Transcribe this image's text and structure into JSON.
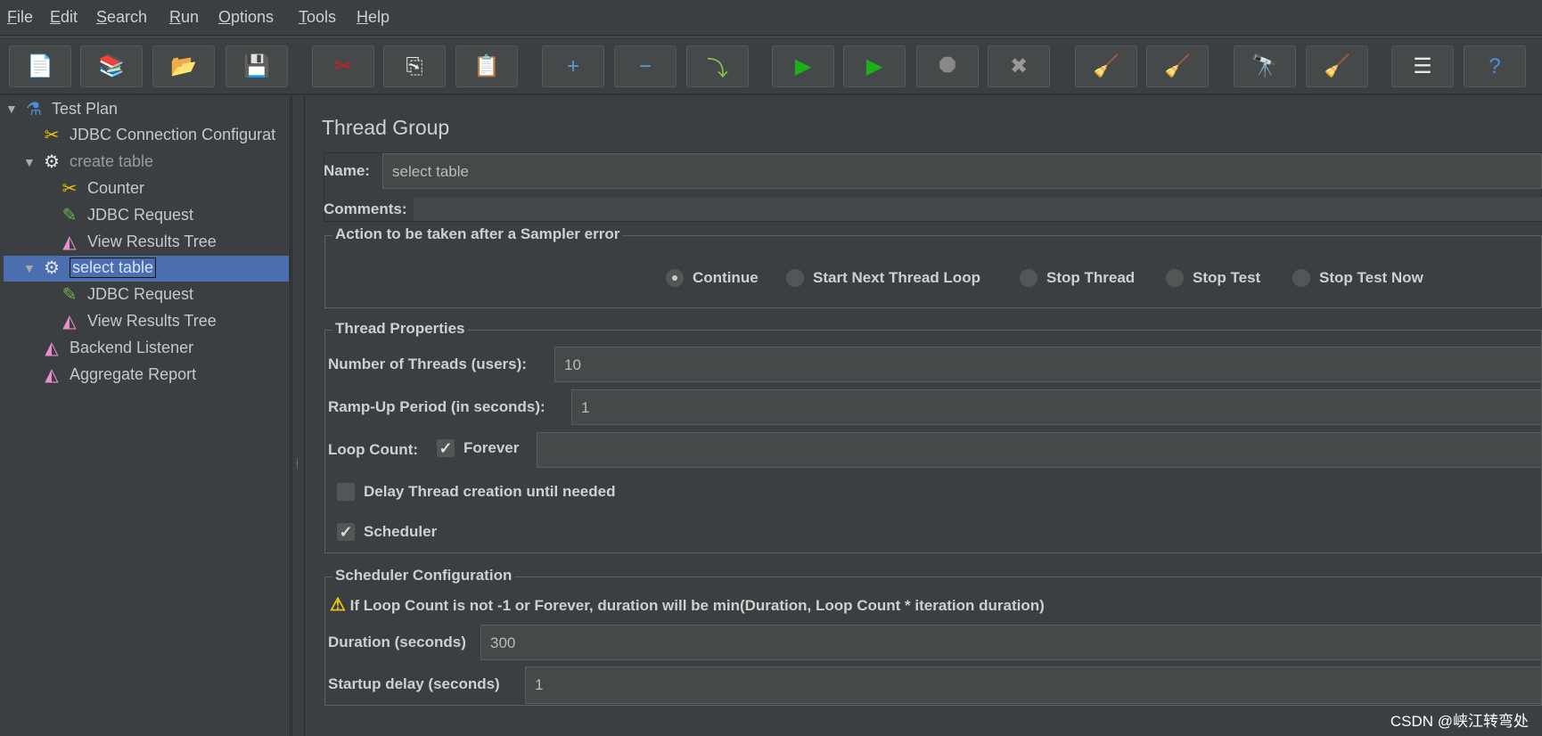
{
  "menu": [
    {
      "label": "File"
    },
    {
      "label": "Edit"
    },
    {
      "label": "Search"
    },
    {
      "label": "Run"
    },
    {
      "label": "Options"
    },
    {
      "label": "Tools"
    },
    {
      "label": "Help"
    }
  ],
  "toolbar": [
    {
      "name": "new-icon",
      "glyph": "📄"
    },
    {
      "name": "templates-icon",
      "glyph": "📚"
    },
    {
      "name": "open-icon",
      "glyph": "📂"
    },
    {
      "name": "save-icon",
      "glyph": "💾"
    },
    {
      "name": "cut-icon",
      "glyph": "✂"
    },
    {
      "name": "copy-icon",
      "glyph": "⎘"
    },
    {
      "name": "paste-icon",
      "glyph": "📋"
    },
    {
      "name": "expand-icon",
      "glyph": "+"
    },
    {
      "name": "collapse-icon",
      "glyph": "−"
    },
    {
      "name": "toggle-icon",
      "glyph": "⤵"
    },
    {
      "name": "start-icon",
      "glyph": "▶"
    },
    {
      "name": "start-no-pauses-icon",
      "glyph": "▶"
    },
    {
      "name": "stop-icon",
      "glyph": "⯃"
    },
    {
      "name": "shutdown-icon",
      "glyph": "✖"
    },
    {
      "name": "clear-icon",
      "glyph": "🧹"
    },
    {
      "name": "clear-all-icon",
      "glyph": "🧹"
    },
    {
      "name": "search-icon",
      "glyph": "🔭"
    },
    {
      "name": "reset-search-icon",
      "glyph": "🧹"
    },
    {
      "name": "function-helper-icon",
      "glyph": "☰"
    },
    {
      "name": "help-icon",
      "glyph": "?"
    }
  ],
  "tree": [
    {
      "label": "Test Plan",
      "icon": "flask-icon",
      "glyph": "⚗",
      "level": 0,
      "toggle": "▼"
    },
    {
      "label": "JDBC Connection Configurat",
      "icon": "config-tools-icon",
      "glyph": "✂",
      "level": 1
    },
    {
      "label": "create table",
      "icon": "thread-group-gear-icon",
      "glyph": "⚙",
      "level": 1,
      "toggle": "▼",
      "disabled": true
    },
    {
      "label": "Counter",
      "icon": "config-tools-icon",
      "glyph": "✂",
      "level": 2
    },
    {
      "label": "JDBC Request",
      "icon": "sampler-pipette-icon",
      "glyph": "✎",
      "level": 2
    },
    {
      "label": "View Results Tree",
      "icon": "listener-graph-icon",
      "glyph": "◭",
      "level": 2
    },
    {
      "label": "select table",
      "icon": "thread-group-gear-icon",
      "glyph": "⚙",
      "level": 1,
      "toggle": "▼",
      "selected": true
    },
    {
      "label": "JDBC Request",
      "icon": "sampler-pipette-icon",
      "glyph": "✎",
      "level": 2
    },
    {
      "label": "View Results Tree",
      "icon": "listener-graph-icon",
      "glyph": "◭",
      "level": 2
    },
    {
      "label": "Backend Listener",
      "icon": "listener-graph-icon",
      "glyph": "◭",
      "level": 1
    },
    {
      "label": "Aggregate Report",
      "icon": "listener-graph-icon",
      "glyph": "◭",
      "level": 1
    }
  ],
  "panel": {
    "title": "Thread Group",
    "name_label": "Name:",
    "name_value": "select table",
    "comments_label": "Comments:",
    "action": {
      "legend": "Action to be taken after a Sampler error",
      "options": [
        "Continue",
        "Start Next Thread Loop",
        "Stop Thread",
        "Stop Test",
        "Stop Test Now"
      ],
      "selected": "Continue"
    },
    "props": {
      "legend": "Thread Properties",
      "threads_label": "Number of Threads (users):",
      "threads_value": "10",
      "rampup_label": "Ramp-Up Period (in seconds):",
      "rampup_value": "1",
      "loop_label": "Loop Count:",
      "forever_label": "Forever",
      "forever_checked": true,
      "loop_value": "",
      "delay_label": "Delay Thread creation until needed",
      "delay_checked": false,
      "scheduler_label": "Scheduler",
      "scheduler_checked": true
    },
    "sched": {
      "legend": "Scheduler Configuration",
      "warning": "If Loop Count is not -1 or Forever, duration will be min(Duration, Loop Count * iteration duration)",
      "duration_label": "Duration (seconds)",
      "duration_value": "300",
      "startup_label": "Startup delay (seconds)",
      "startup_value": "1"
    }
  },
  "colors": {
    "background": "#3c3f41",
    "selection": "#4b6eaf",
    "input": "#45494a"
  },
  "watermark": "CSDN @峡江转弯处"
}
